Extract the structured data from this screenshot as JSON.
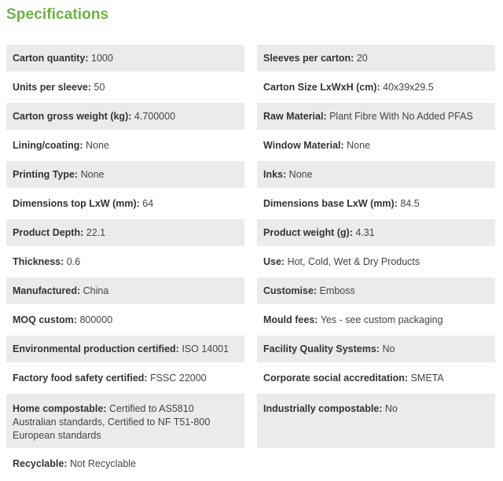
{
  "title": "Specifications",
  "rows": [
    {
      "left": {
        "key": "Carton quantity:",
        "value": "1000"
      },
      "right": {
        "key": "Sleeves per carton:",
        "value": "20"
      }
    },
    {
      "left": {
        "key": "Units per sleeve:",
        "value": "50"
      },
      "right": {
        "key": "Carton Size LxWxH (cm):",
        "value": "40x39x29.5"
      }
    },
    {
      "left": {
        "key": "Carton gross weight (kg):",
        "value": "4.700000"
      },
      "right": {
        "key": "Raw Material:",
        "value": "Plant Fibre With No Added PFAS"
      }
    },
    {
      "left": {
        "key": "Lining/coating:",
        "value": "None"
      },
      "right": {
        "key": "Window Material:",
        "value": "None"
      }
    },
    {
      "left": {
        "key": "Printing Type:",
        "value": "None"
      },
      "right": {
        "key": "Inks:",
        "value": "None"
      }
    },
    {
      "left": {
        "key": "Dimensions top LxW (mm):",
        "value": "64"
      },
      "right": {
        "key": "Dimensions base LxW (mm):",
        "value": "84.5"
      }
    },
    {
      "left": {
        "key": "Product Depth:",
        "value": "22.1"
      },
      "right": {
        "key": "Product weight (g):",
        "value": "4.31"
      }
    },
    {
      "left": {
        "key": "Thickness:",
        "value": "0.6"
      },
      "right": {
        "key": "Use:",
        "value": "Hot, Cold, Wet & Dry Products"
      }
    },
    {
      "left": {
        "key": "Manufactured:",
        "value": "China"
      },
      "right": {
        "key": "Customise:",
        "value": "Emboss"
      }
    },
    {
      "left": {
        "key": "MOQ custom:",
        "value": "800000"
      },
      "right": {
        "key": "Mould fees:",
        "value": "Yes - see custom packaging"
      }
    },
    {
      "left": {
        "key": "Environmental production certified:",
        "value": "ISO 14001"
      },
      "right": {
        "key": "Facility Quality Systems:",
        "value": "No"
      }
    },
    {
      "left": {
        "key": "Factory food safety certified:",
        "value": "FSSC 22000"
      },
      "right": {
        "key": "Corporate social accreditation:",
        "value": "SMETA"
      }
    },
    {
      "left": {
        "key": "Home compostable:",
        "value": "Certified to AS5810 Australian standards, Certified to NF T51-800 European standards"
      },
      "right": {
        "key": "Industrially compostable:",
        "value": "No"
      }
    },
    {
      "left": {
        "key": "Recyclable:",
        "value": "Not Recyclable"
      },
      "right": {
        "key": "",
        "value": ""
      }
    }
  ],
  "colors": {
    "title": "#6bb244",
    "row_shade": "#ebebeb",
    "text": "#333333"
  }
}
